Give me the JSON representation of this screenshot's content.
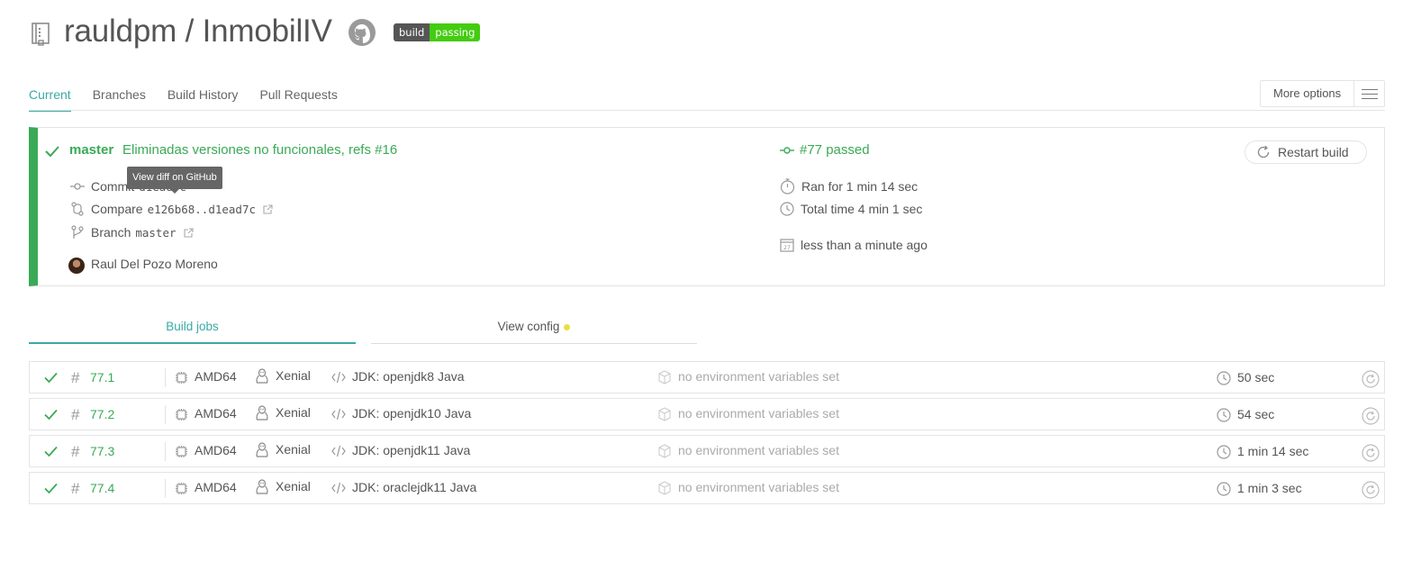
{
  "header": {
    "repo_title": "rauldpm / InmobilIV",
    "badge_left": "build",
    "badge_right": "passing",
    "badge_color": "#44cc11"
  },
  "tabs": [
    {
      "label": "Current",
      "active": true
    },
    {
      "label": "Branches"
    },
    {
      "label": "Build History"
    },
    {
      "label": "Pull Requests"
    }
  ],
  "more_options": {
    "label": "More options"
  },
  "build": {
    "branch": "master",
    "message": "Eliminadas versiones no funcionales, refs #16",
    "commit_label": "Commit",
    "commit_sha": "d1ead7c",
    "tooltip": "View diff on GitHub",
    "compare_label": "Compare",
    "compare_range": "e126b68..d1ead7c",
    "branch_label": "Branch",
    "branch_value": "master",
    "author": "Raul Del Pozo Moreno",
    "status": "#77 passed",
    "ran_for": "Ran for 1 min 14 sec",
    "total_time": "Total time 4 min 1 sec",
    "finished": "less than a minute ago",
    "restart_label": "Restart build",
    "status_color": "#39aa56"
  },
  "subtabs": {
    "build_jobs": "Build jobs",
    "view_config": "View config"
  },
  "jobs": [
    {
      "number": "77.1",
      "cpu": "AMD64",
      "os": "Xenial",
      "jdk": "JDK: openjdk8 Java",
      "env": "no environment variables set",
      "duration": "50 sec"
    },
    {
      "number": "77.2",
      "cpu": "AMD64",
      "os": "Xenial",
      "jdk": "JDK: openjdk10 Java",
      "env": "no environment variables set",
      "duration": "54 sec"
    },
    {
      "number": "77.3",
      "cpu": "AMD64",
      "os": "Xenial",
      "jdk": "JDK: openjdk11 Java",
      "env": "no environment variables set",
      "duration": "1 min 14 sec"
    },
    {
      "number": "77.4",
      "cpu": "AMD64",
      "os": "Xenial",
      "jdk": "JDK: oraclejdk11 Java",
      "env": "no environment variables set",
      "duration": "1 min 3 sec"
    }
  ]
}
